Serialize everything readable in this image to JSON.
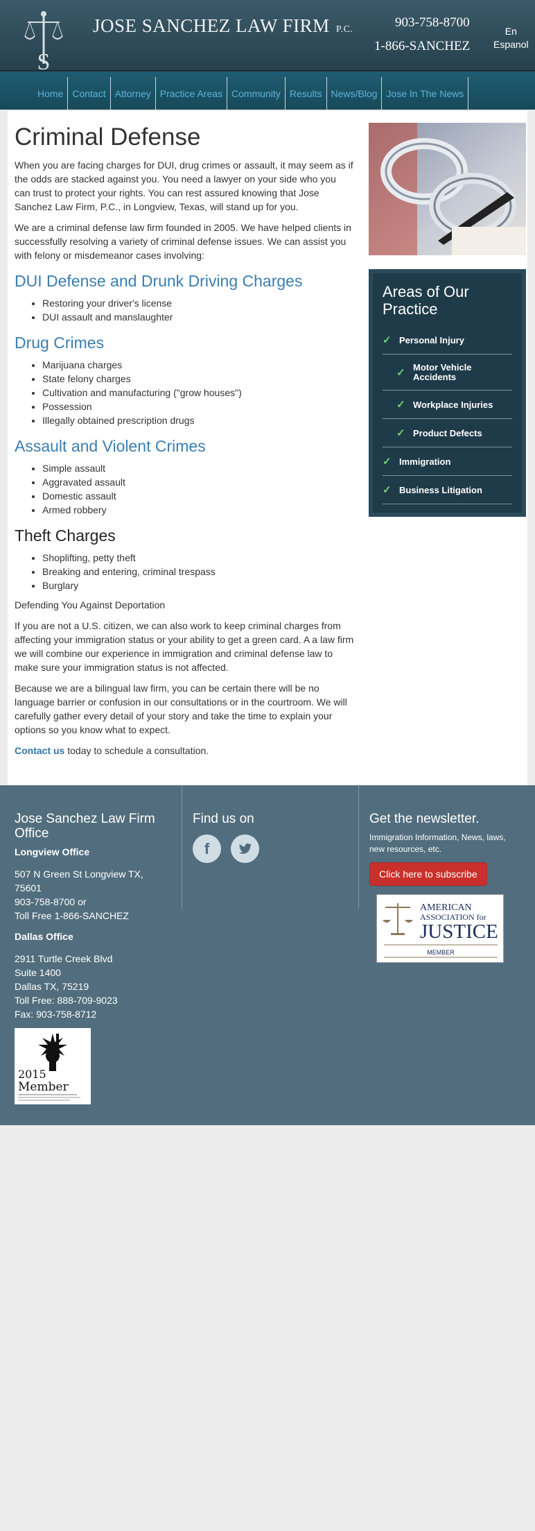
{
  "header": {
    "firm_name": "JOSE SANCHEZ LAW FIRM",
    "firm_suffix": "P.C.",
    "phone_primary": "903-758-8700",
    "phone_vanity": "1-866-SANCHEZ",
    "lang_en": "En",
    "lang_es": "Espanol"
  },
  "nav": {
    "items": [
      {
        "label": "Home"
      },
      {
        "label": "Contact"
      },
      {
        "label": "Attorney"
      },
      {
        "label": "Practice Areas"
      },
      {
        "label": "Community"
      },
      {
        "label": "Results"
      },
      {
        "label": "News/Blog"
      },
      {
        "label": "Jose In The News"
      }
    ]
  },
  "content": {
    "title": "Criminal Defense",
    "intro1": "When you are facing charges for DUI, drug crimes or assault, it may seem as if the odds are stacked against you. You need a lawyer on your side who you can trust to protect your rights. You can rest assured knowing that Jose Sanchez Law Firm, P.C., in Longview, Texas, will stand up for you.",
    "intro2": "We are a criminal defense law firm founded in 2005. We have helped clients in successfully resolving a variety of criminal defense issues. We can assist you with felony or misdemeanor cases involving:",
    "sections": [
      {
        "heading": "DUI Defense and Drunk Driving Charges",
        "items": [
          "Restoring your driver's license",
          "DUI assault and manslaughter"
        ]
      },
      {
        "heading": "Drug Crimes",
        "items": [
          "Marijuana charges",
          "State felony charges",
          "Cultivation and manufacturing (\"grow houses\")",
          "Possession",
          "Illegally obtained prescription drugs"
        ]
      },
      {
        "heading": "Assault and Violent Crimes",
        "items": [
          "Simple assault",
          "Aggravated assault",
          "Domestic assault",
          "Armed robbery"
        ]
      },
      {
        "heading": "Theft Charges",
        "items": [
          "Shoplifting, petty theft",
          "Breaking and entering, criminal trespass",
          "Burglary"
        ]
      }
    ],
    "deportation_heading": "Defending You Against Deportation",
    "deportation_p1": "If you are not a U.S. citizen, we can also work to keep criminal charges from affecting your immigration status or your ability to get a green card. A a law firm we will combine our experience in immigration and criminal defense law to make sure your immigration status is not affected.",
    "deportation_p2": "Because we are a bilingual law firm, you can be certain there will be no language barrier or confusion in our consultations or in the courtroom. We will carefully gather every detail of your story and take the time to explain your options so you know what to expect.",
    "contact_link": "Contact us",
    "contact_rest": " today to schedule a consultation."
  },
  "sidebar": {
    "title": "Areas of Our Practice",
    "items": [
      {
        "label": "Personal Injury"
      },
      {
        "label": "Motor Vehicle Accidents"
      },
      {
        "label": "Workplace Injuries"
      },
      {
        "label": "Product Defects"
      },
      {
        "label": "Immigration"
      },
      {
        "label": "Business Litigation"
      }
    ]
  },
  "footer": {
    "office_title": "Jose Sanchez Law Firm Office",
    "longview_label": "Longview Office",
    "longview_lines": [
      "507 N Green St Longview TX,",
      "75601",
      "903-758-8700 or",
      "Toll Free 1-866-SANCHEZ"
    ],
    "dallas_label": "Dallas Office",
    "dallas_lines": [
      "2911 Turtle Creek Blvd",
      "Suite 1400",
      "Dallas TX, 75219",
      "Toll Free: 888-709-9023",
      "Fax: 903-758-8712"
    ],
    "find_us": "Find us on",
    "facebook_glyph": "f",
    "newsletter_title": "Get the newsletter.",
    "newsletter_text": "Immigration Information, News, laws, new resources, etc.",
    "subscribe_label": "Click here to subscribe",
    "aaj_line1": "AMERICAN",
    "aaj_line2": "ASSOCIATION for",
    "aaj_line3": "JUSTICE",
    "aaj_member": "MEMBER",
    "badge_year": "2015",
    "badge_member": "Member"
  }
}
